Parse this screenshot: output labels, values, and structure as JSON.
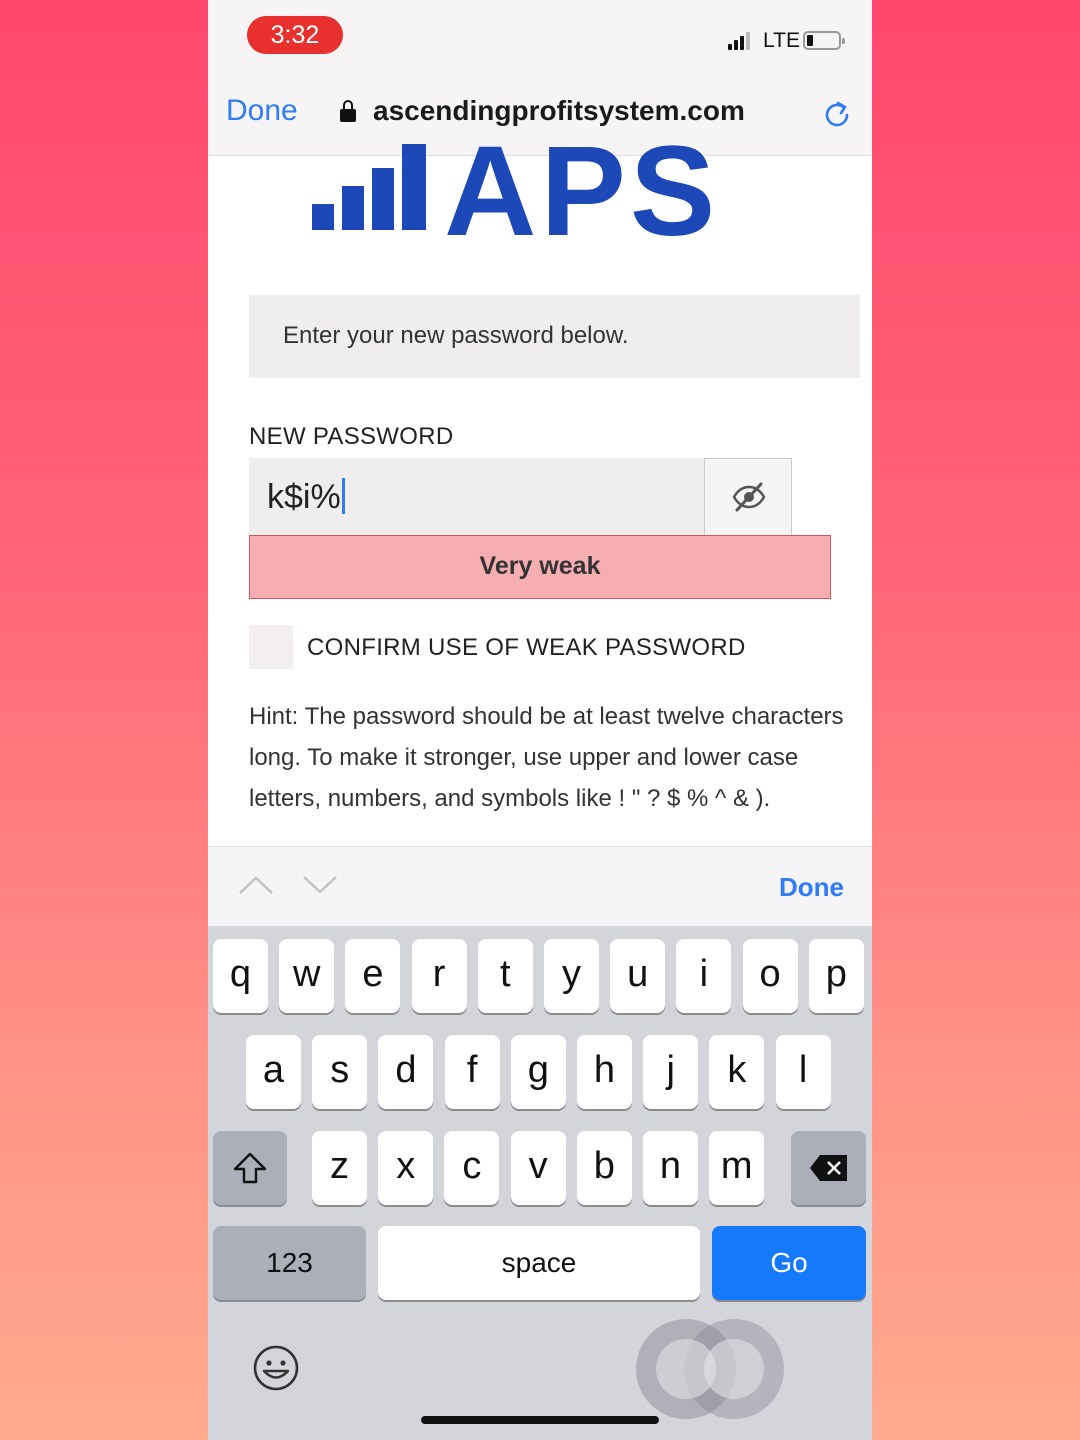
{
  "status_bar": {
    "time": "3:32",
    "network": "LTE"
  },
  "browser_bar": {
    "done_label": "Done",
    "url": "ascendingprofitsystem.com"
  },
  "page": {
    "logo_text": "APS",
    "info_message": "Enter your new password below.",
    "new_password_label": "NEW PASSWORD",
    "password_value": "k$i%",
    "strength_label": "Very weak",
    "confirm_weak_label": "CONFIRM USE OF WEAK PASSWORD",
    "hint": "Hint: The password should be at least twelve characters long. To make it stronger, use upper and lower case letters, numbers, and symbols like ! \" ? $ % ^ & )."
  },
  "accessory_bar": {
    "done_label": "Done"
  },
  "keyboard": {
    "row1": [
      "q",
      "w",
      "e",
      "r",
      "t",
      "y",
      "u",
      "i",
      "o",
      "p"
    ],
    "row2": [
      "a",
      "s",
      "d",
      "f",
      "g",
      "h",
      "j",
      "k",
      "l"
    ],
    "row3": [
      "z",
      "x",
      "c",
      "v",
      "b",
      "n",
      "m"
    ],
    "numbers_label": "123",
    "space_label": "space",
    "go_label": "Go"
  },
  "colors": {
    "accent": "#2f7cf6",
    "logo": "#1d48b8",
    "strength_bg": "#f6aeb2",
    "strength_border": "#d7535b",
    "go_key": "#1479fb"
  }
}
